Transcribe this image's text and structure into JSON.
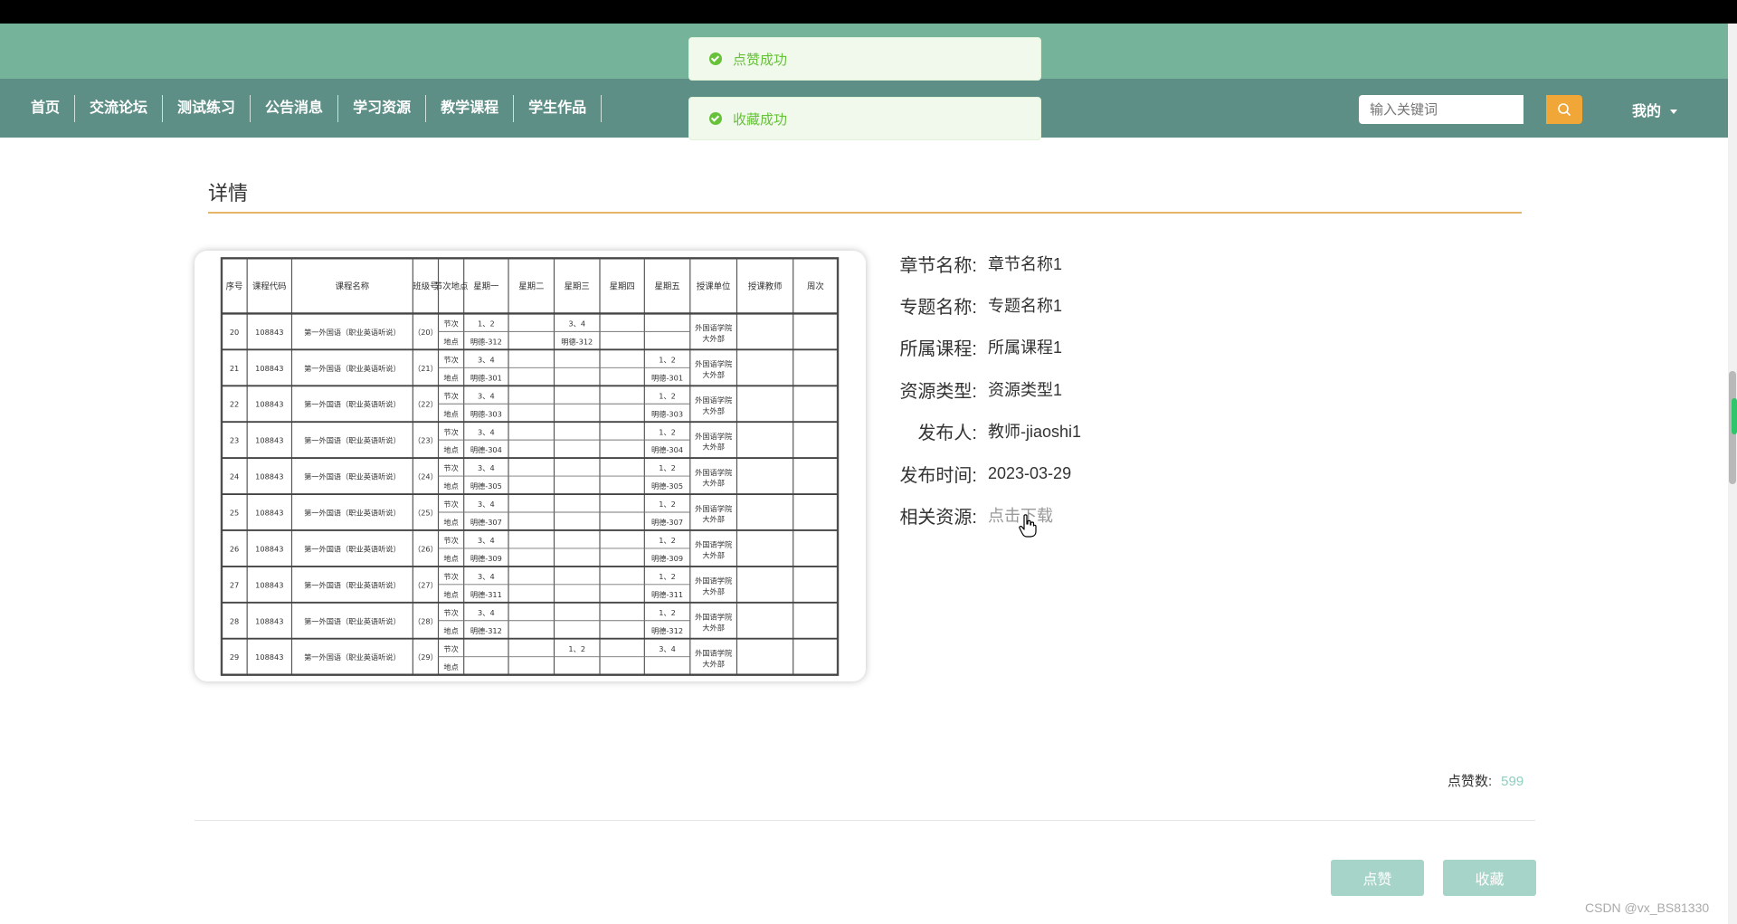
{
  "nav": {
    "items": [
      "首页",
      "交流论坛",
      "测试练习",
      "公告消息",
      "学习资源",
      "教学课程",
      "学生作品"
    ],
    "search_placeholder": "输入关键词",
    "user_menu": "我的"
  },
  "toasts": [
    "点赞成功",
    "收藏成功"
  ],
  "detail": {
    "title": "详情",
    "fields": [
      {
        "label": "章节名称:",
        "value": "章节名称1"
      },
      {
        "label": "专题名称:",
        "value": "专题名称1"
      },
      {
        "label": "所属课程:",
        "value": "所属课程1"
      },
      {
        "label": "资源类型:",
        "value": "资源类型1"
      },
      {
        "label": "发布人:",
        "value": "教师-jiaoshi1"
      },
      {
        "label": "发布时间:",
        "value": "2023-03-29"
      },
      {
        "label": "相关资源:",
        "value": "点击下载"
      }
    ],
    "like_label": "点赞数:",
    "like_count": "599"
  },
  "buttons": {
    "like": "点赞",
    "favorite": "收藏"
  },
  "watermark": "CSDN @vx_BS81330",
  "schedule_table": {
    "headers": [
      "序号",
      "课程代码",
      "课程名称",
      "班级号",
      "节次地点",
      "星期一",
      "星期二",
      "星期三",
      "星期四",
      "星期五",
      "授课单位",
      "授课教师",
      "周次"
    ],
    "row_labels": [
      "节次",
      "地点"
    ],
    "rows": [
      {
        "no": "20",
        "code": "108843",
        "name": "第一外国语（职业英语听说）",
        "class": "（20）",
        "mon": "1、2",
        "wed": "3、4",
        "fri": "",
        "mon_room": "明德-312",
        "wed_room": "明德-312",
        "fri_room": "",
        "unit": "外国语学院大外部"
      },
      {
        "no": "21",
        "code": "108843",
        "name": "第一外国语（职业英语听说）",
        "class": "（21）",
        "mon": "3、4",
        "wed": "",
        "fri": "1、2",
        "mon_room": "明德-301",
        "wed_room": "",
        "fri_room": "明德-301",
        "unit": "外国语学院大外部"
      },
      {
        "no": "22",
        "code": "108843",
        "name": "第一外国语（职业英语听说）",
        "class": "（22）",
        "mon": "3、4",
        "wed": "",
        "fri": "1、2",
        "mon_room": "明德-303",
        "wed_room": "",
        "fri_room": "明德-303",
        "unit": "外国语学院大外部"
      },
      {
        "no": "23",
        "code": "108843",
        "name": "第一外国语（职业英语听说）",
        "class": "（23）",
        "mon": "3、4",
        "wed": "",
        "fri": "1、2",
        "mon_room": "明德-304",
        "wed_room": "",
        "fri_room": "明德-304",
        "unit": "外国语学院大外部"
      },
      {
        "no": "24",
        "code": "108843",
        "name": "第一外国语（职业英语听说）",
        "class": "（24）",
        "mon": "3、4",
        "wed": "",
        "fri": "1、2",
        "mon_room": "明德-305",
        "wed_room": "",
        "fri_room": "明德-305",
        "unit": "外国语学院大外部"
      },
      {
        "no": "25",
        "code": "108843",
        "name": "第一外国语（职业英语听说）",
        "class": "（25）",
        "mon": "3、4",
        "wed": "",
        "fri": "1、2",
        "mon_room": "明德-307",
        "wed_room": "",
        "fri_room": "明德-307",
        "unit": "外国语学院大外部"
      },
      {
        "no": "26",
        "code": "108843",
        "name": "第一外国语（职业英语听说）",
        "class": "（26）",
        "mon": "3、4",
        "wed": "",
        "fri": "1、2",
        "mon_room": "明德-309",
        "wed_room": "",
        "fri_room": "明德-309",
        "unit": "外国语学院大外部"
      },
      {
        "no": "27",
        "code": "108843",
        "name": "第一外国语（职业英语听说）",
        "class": "（27）",
        "mon": "3、4",
        "wed": "",
        "fri": "1、2",
        "mon_room": "明德-311",
        "wed_room": "",
        "fri_room": "明德-311",
        "unit": "外国语学院大外部"
      },
      {
        "no": "28",
        "code": "108843",
        "name": "第一外国语（职业英语听说）",
        "class": "（28）",
        "mon": "3、4",
        "wed": "",
        "fri": "1、2",
        "mon_room": "明德-312",
        "wed_room": "",
        "fri_room": "明德-312",
        "unit": "外国语学院大外部"
      },
      {
        "no": "29",
        "code": "108843",
        "name": "第一外国语（职业英语听说）",
        "class": "（29）",
        "mon": "",
        "wed": "1、2",
        "fri": "3、4",
        "mon_room": "",
        "wed_room": "",
        "fri_room": "",
        "unit": "外国语学院大外部"
      }
    ]
  }
}
